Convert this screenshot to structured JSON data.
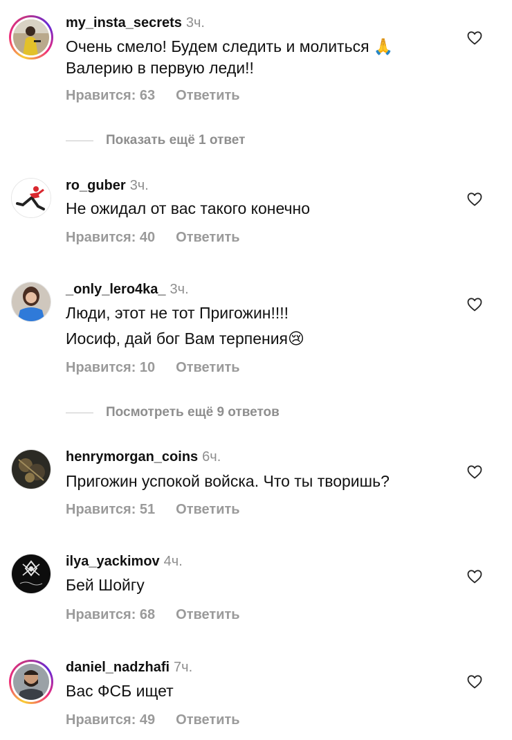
{
  "comments": [
    {
      "username": "my_insta_secrets",
      "time": "3ч.",
      "lines": [
        "Очень смело! Будем следить и молиться 🙏",
        "Валерию в первую леди!!"
      ],
      "likes": "Нравится: 63",
      "reply": "Ответить",
      "avatar": "woman-yellow-avatar"
    },
    {
      "username": "ro_guber",
      "time": "3ч.",
      "lines": [
        "Не ожидал от вас такого конечно"
      ],
      "likes": "Нравится: 40",
      "reply": "Ответить",
      "avatar": "runner-avatar"
    },
    {
      "username": "_only_lero4ka_",
      "time": "3ч.",
      "lines": [
        "Люди, этот не тот Пригожин!!!!",
        "Иосиф, дай бог Вам терпения😢"
      ],
      "likes": "Нравится: 10",
      "reply": "Ответить",
      "avatar": "girl-blue-avatar"
    },
    {
      "username": "henrymorgan_coins",
      "time": "6ч.",
      "lines": [
        "Пригожин успокой войска. Что ты творишь?"
      ],
      "likes": "Нравится: 51",
      "reply": "Ответить",
      "avatar": "dark-coins-avatar"
    },
    {
      "username": "ilya_yackimov",
      "time": "4ч.",
      "lines": [
        "Бей Шойгу"
      ],
      "likes": "Нравится: 68",
      "reply": "Ответить",
      "avatar": "ornament-logo-avatar"
    },
    {
      "username": "daniel_nadzhafi",
      "time": "7ч.",
      "lines": [
        "Вас ФСБ ищет"
      ],
      "likes": "Нравится: 49",
      "reply": "Ответить",
      "avatar": "bearded-man-avatar"
    }
  ],
  "more_replies": [
    "Показать ещё 1 ответ",
    "Посмотреть ещё 9 ответов"
  ],
  "colors": {
    "username": "#111111",
    "secondary": "#8e8e8e",
    "story_ring": [
      "#f9ce34",
      "#ee2a7b",
      "#6228d7"
    ]
  },
  "icons": {
    "like": "heart-outline-icon"
  }
}
